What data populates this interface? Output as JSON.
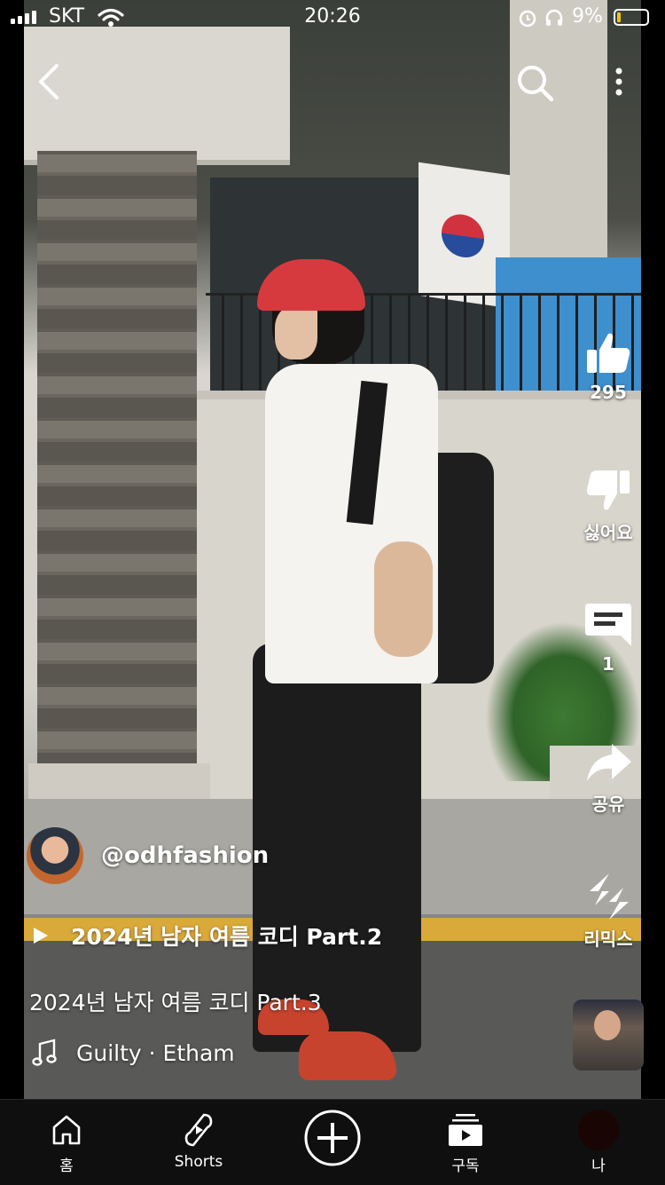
{
  "status_bar": {
    "carrier": "SKT",
    "time": "20:26",
    "battery_pct": "9%",
    "battery_level": 0.09,
    "battery_color": "#f1c40f"
  },
  "top_bar": {
    "back_icon": "chevron-left-icon",
    "search_icon": "search-icon",
    "more_icon": "more-vertical-icon"
  },
  "actions": {
    "like": {
      "icon": "thumbs-up-icon",
      "label": "295"
    },
    "dislike": {
      "icon": "thumbs-down-icon",
      "label": "싫어요"
    },
    "comments": {
      "icon": "comment-icon",
      "label": "1"
    },
    "share": {
      "icon": "share-icon",
      "label": "공유"
    },
    "remix": {
      "icon": "remix-icon",
      "label": "리믹스"
    }
  },
  "video": {
    "channel": "@odhfashion",
    "playlist": "2024년 남자 여름 코디 Part.2",
    "title": "2024년 남자 여름 코디 Part.3",
    "music": "Guilty · Etham"
  },
  "nav": {
    "home": "홈",
    "shorts": "Shorts",
    "subscriptions": "구독",
    "me": "나"
  }
}
